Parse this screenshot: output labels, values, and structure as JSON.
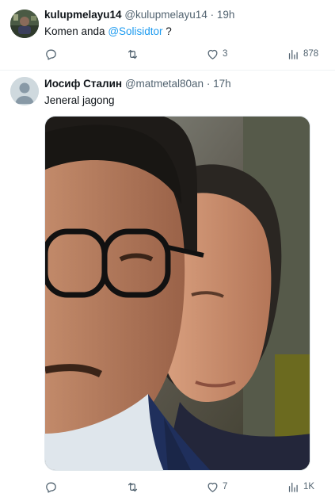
{
  "posts": [
    {
      "name": "kulupmelayu14",
      "handle": "@kulupmelayu14",
      "dot": "·",
      "time": "19h",
      "text_before": "Komen anda ",
      "mention": "@Solisidtor",
      "text_after": " ?",
      "actions": {
        "reply_count": "",
        "repost_count": "",
        "like_count": "3",
        "views_count": "878"
      },
      "avatar_icon": "avatar-photo"
    },
    {
      "name": "Иосиф Сталин",
      "handle": "@matmetal80an",
      "dot": "·",
      "time": "17h",
      "text": "Jeneral jagong",
      "media_icon": "photo-two-men",
      "actions": {
        "reply_count": "",
        "repost_count": "",
        "like_count": "7",
        "views_count": "1K"
      },
      "avatar_icon": "default-avatar"
    }
  ],
  "icons": {
    "reply": "reply-icon",
    "repost": "repost-icon",
    "like": "like-icon",
    "views": "views-icon"
  },
  "colors": {
    "accent": "#1d9bf0",
    "text": "#0f1419",
    "secondary": "#536471",
    "divider": "#eff3f4"
  }
}
